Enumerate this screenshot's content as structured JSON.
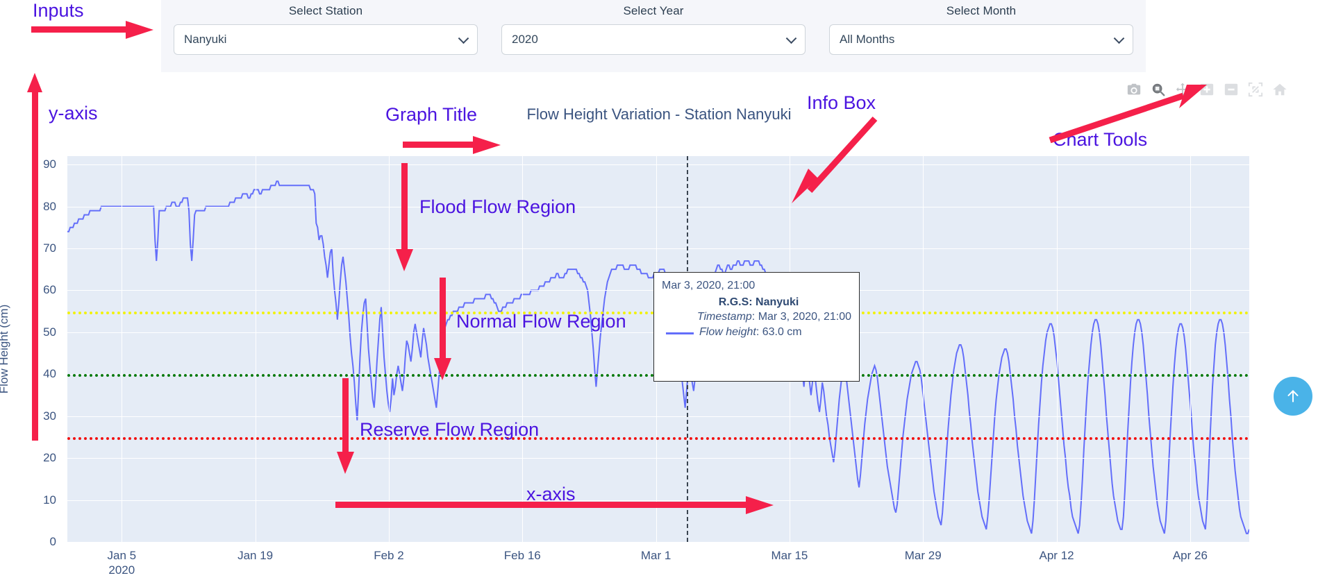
{
  "inputs": {
    "station": {
      "label": "Select Station",
      "value": "Nanyuki",
      "icon": "chevron-down-icon"
    },
    "year": {
      "label": "Select Year",
      "value": "2020",
      "icon": "chevron-down-icon"
    },
    "month": {
      "label": "Select Month",
      "value": "All Months",
      "icon": "chevron-down-icon"
    }
  },
  "modebar": {
    "buttons": [
      {
        "name": "download-plot-icon",
        "title": "Download plot as a png"
      },
      {
        "name": "zoom-icon",
        "title": "Zoom"
      },
      {
        "name": "pan-icon",
        "title": "Pan"
      },
      {
        "name": "zoom-in-icon",
        "title": "Zoom in"
      },
      {
        "name": "zoom-out-icon",
        "title": "Zoom out"
      },
      {
        "name": "autoscale-icon",
        "title": "Autoscale"
      },
      {
        "name": "reset-axes-icon",
        "title": "Reset axes"
      }
    ]
  },
  "info_box": {
    "header": "Mar 3, 2020, 21:00",
    "station_label": "R.G.S:",
    "station_value": "Nanyuki",
    "timestamp_label": "Timestamp",
    "timestamp_value": "Mar 3, 2020, 21:00",
    "flow_label": "Flow height",
    "flow_value": "63.0 cm"
  },
  "annotations": [
    {
      "name": "annotation-inputs",
      "text": "Inputs"
    },
    {
      "name": "annotation-y-axis",
      "text": "y-axis"
    },
    {
      "name": "annotation-graph-title",
      "text": "Graph Title"
    },
    {
      "name": "annotation-info-box",
      "text": "Info Box"
    },
    {
      "name": "annotation-chart-tools",
      "text": "Chart Tools"
    },
    {
      "name": "annotation-flood-flow-region",
      "text": "Flood Flow Region"
    },
    {
      "name": "annotation-normal-flow-region",
      "text": "Normal Flow Region"
    },
    {
      "name": "annotation-reserve-flow-region",
      "text": "Reserve Flow Region"
    },
    {
      "name": "annotation-x-axis",
      "text": "x-axis"
    }
  ],
  "scroll_top": {
    "name": "scroll-to-top-button",
    "icon": "arrow-up-icon",
    "color": "#4ab3e8"
  },
  "chart_data": {
    "type": "line",
    "title": "Flow Height Variation - Station Nanyuki",
    "xlabel": "",
    "ylabel": "Flow Height (cm)",
    "ylim": [
      0,
      92
    ],
    "yticks": [
      0,
      10,
      20,
      30,
      40,
      50,
      60,
      70,
      80,
      90
    ],
    "xticks": [
      "Jan 5\n2020",
      "Jan 19",
      "Feb 2",
      "Feb 16",
      "Mar 1",
      "Mar 15",
      "Mar 29",
      "Apr 12",
      "Apr 26"
    ],
    "xtick_positions_pct": [
      4.6,
      15.9,
      27.2,
      38.5,
      49.8,
      61.1,
      72.4,
      83.7,
      95.0
    ],
    "grid": true,
    "legend": "none",
    "plot_bgcolor": "#e5ecf6",
    "line_color": "#636efa",
    "cursor_line": {
      "label": "Mar 3, 2020, 21:00",
      "x_pct": 52.4,
      "color": "#3a4450",
      "style": "dashed"
    },
    "threshold_lines": [
      {
        "name": "flood-threshold",
        "value": 55,
        "color": "#f2f20a",
        "style": "dotted"
      },
      {
        "name": "normal-threshold",
        "value": 40,
        "color": "#0a7a10",
        "style": "dotted"
      },
      {
        "name": "reserve-threshold",
        "value": 25,
        "color": "#f21111",
        "style": "dotted"
      }
    ],
    "series": [
      {
        "name": "Flow height",
        "unit": "cm",
        "values": [
          74,
          74,
          75,
          75,
          75,
          76,
          76,
          76,
          77,
          77,
          77,
          77,
          78,
          78,
          78,
          78,
          79,
          79,
          79,
          79,
          79,
          79,
          79,
          79,
          80,
          80,
          80,
          80,
          80,
          80,
          80,
          80,
          80,
          80,
          80,
          80,
          80,
          80,
          80,
          80,
          80,
          80,
          80,
          80,
          80,
          80,
          80,
          80,
          80,
          80,
          80,
          80,
          80,
          80,
          80,
          80,
          80,
          80,
          80,
          80,
          80,
          80,
          72,
          67,
          72,
          79,
          79,
          79,
          79,
          79,
          80,
          80,
          80,
          80,
          81,
          81,
          81,
          80,
          80,
          80,
          81,
          81,
          82,
          82,
          82,
          82,
          79,
          71,
          67,
          72,
          78,
          79,
          79,
          79,
          79,
          79,
          79,
          79,
          80,
          80,
          80,
          80,
          80,
          80,
          80,
          80,
          80,
          80,
          80,
          80,
          80,
          80,
          80,
          80,
          80,
          81,
          81,
          81,
          81,
          82,
          82,
          82,
          82,
          82,
          83,
          83,
          83,
          83,
          82,
          82,
          83,
          83,
          84,
          84,
          84,
          84,
          83,
          83,
          84,
          84,
          84,
          84,
          84,
          84,
          85,
          85,
          85,
          85,
          86,
          86,
          85,
          85,
          85,
          85,
          85,
          85,
          85,
          85,
          85,
          85,
          85,
          85,
          85,
          85,
          85,
          85,
          85,
          85,
          85,
          85,
          85,
          85,
          84,
          84,
          84,
          83,
          76,
          75,
          72,
          73,
          73,
          71,
          68,
          66,
          63,
          66,
          69,
          70,
          64,
          60,
          57,
          53,
          57,
          62,
          66,
          68,
          65,
          62,
          58,
          54,
          49,
          45,
          42,
          38,
          33,
          29,
          36,
          44,
          50,
          54,
          57,
          58,
          52,
          46,
          42,
          38,
          34,
          32,
          37,
          43,
          48,
          53,
          56,
          50,
          44,
          40,
          36,
          33,
          31,
          34,
          39,
          35,
          37,
          40,
          42,
          40,
          38,
          36,
          39,
          44,
          48,
          47,
          45,
          43,
          46,
          50,
          52,
          50,
          48,
          46,
          44,
          48,
          51,
          49,
          47,
          44,
          42,
          40,
          38,
          36,
          34,
          32,
          36,
          40,
          44,
          47,
          49,
          51,
          52,
          53,
          53,
          54,
          54,
          55,
          55,
          55,
          55,
          56,
          56,
          56,
          56,
          57,
          57,
          57,
          57,
          57,
          57,
          57,
          58,
          58,
          58,
          58,
          58,
          58,
          58,
          58,
          59,
          59,
          59,
          59,
          58,
          58,
          57,
          57,
          56,
          55,
          55,
          55,
          56,
          56,
          56,
          57,
          57,
          57,
          57,
          57,
          58,
          58,
          58,
          58,
          58,
          59,
          59,
          59,
          59,
          59,
          59,
          59,
          60,
          60,
          60,
          60,
          60,
          60,
          61,
          61,
          61,
          61,
          62,
          62,
          62,
          62,
          63,
          63,
          63,
          63,
          64,
          64,
          63,
          63,
          63,
          63,
          64,
          64,
          65,
          65,
          65,
          65,
          65,
          65,
          65,
          64,
          64,
          63,
          63,
          62,
          62,
          61,
          60,
          57,
          54,
          50,
          46,
          41,
          37,
          41,
          45,
          49,
          52,
          55,
          58,
          60,
          62,
          63,
          64,
          65,
          65,
          65,
          65,
          66,
          66,
          66,
          66,
          66,
          65,
          65,
          65,
          65,
          66,
          66,
          66,
          66,
          66,
          65,
          65,
          65,
          64,
          64,
          64,
          64,
          64,
          63,
          63,
          63,
          63,
          64,
          64,
          64,
          64,
          65,
          65,
          65,
          65,
          64,
          64,
          63,
          63,
          63,
          62,
          62,
          58,
          54,
          50,
          46,
          42,
          38,
          35,
          32,
          36,
          40,
          43,
          40,
          38,
          36,
          39,
          44,
          42,
          45,
          49,
          52,
          55,
          57,
          59,
          60,
          61,
          62,
          63,
          64,
          64,
          65,
          66,
          66,
          65,
          65,
          64,
          64,
          65,
          66,
          66,
          65,
          65,
          66,
          66,
          66,
          67,
          67,
          66,
          66,
          66,
          67,
          67,
          67,
          67,
          66,
          66,
          66,
          67,
          67,
          67,
          67,
          66,
          66,
          65,
          65,
          64,
          64,
          63,
          62,
          62,
          61,
          61,
          60,
          59,
          58,
          58,
          57,
          56,
          55,
          54,
          53,
          51,
          49,
          47,
          45,
          43,
          41,
          39,
          43,
          47,
          44,
          40,
          37,
          41,
          45,
          42,
          38,
          35,
          38,
          42,
          39,
          36,
          33,
          31,
          34,
          38,
          36,
          33,
          30,
          28,
          25,
          23,
          21,
          19,
          22,
          26,
          30,
          34,
          37,
          40,
          42,
          41,
          39,
          36,
          33,
          30,
          27,
          24,
          21,
          18,
          15,
          13,
          16,
          20,
          24,
          28,
          31,
          34,
          36,
          38,
          40,
          41,
          42,
          41,
          39,
          36,
          33,
          30,
          27,
          24,
          21,
          18,
          16,
          14,
          12,
          10,
          8,
          7,
          9,
          13,
          17,
          21,
          25,
          28,
          31,
          34,
          36,
          38,
          40,
          41,
          42,
          43,
          43,
          42,
          41,
          39,
          36,
          33,
          30,
          27,
          24,
          21,
          18,
          15,
          12,
          10,
          8,
          6,
          5,
          4,
          7,
          12,
          17,
          22,
          27,
          31,
          35,
          38,
          41,
          43,
          45,
          46,
          47,
          47,
          46,
          44,
          41,
          38,
          35,
          31,
          28,
          24,
          21,
          18,
          15,
          12,
          10,
          8,
          6,
          5,
          4,
          3,
          6,
          10,
          15,
          20,
          25,
          30,
          34,
          37,
          40,
          42,
          44,
          45,
          46,
          46,
          45,
          43,
          40,
          37,
          34,
          30,
          27,
          23,
          20,
          17,
          14,
          11,
          9,
          7,
          5,
          4,
          3,
          2,
          5,
          10,
          16,
          22,
          28,
          33,
          38,
          42,
          45,
          48,
          50,
          51,
          52,
          52,
          51,
          49,
          46,
          43,
          39,
          35,
          31,
          27,
          23,
          20,
          16,
          13,
          11,
          8,
          6,
          5,
          4,
          3,
          2,
          4,
          9,
          15,
          22,
          28,
          34,
          39,
          43,
          47,
          50,
          52,
          53,
          53,
          52,
          50,
          47,
          43,
          39,
          35,
          30,
          26,
          22,
          18,
          14,
          11,
          9,
          7,
          5,
          4,
          3,
          3,
          6,
          12,
          19,
          26,
          32,
          38,
          43,
          47,
          50,
          52,
          53,
          53,
          52,
          50,
          47,
          43,
          39,
          35,
          30,
          26,
          22,
          18,
          15,
          12,
          9,
          7,
          5,
          4,
          3,
          2,
          5,
          11,
          18,
          25,
          31,
          37,
          42,
          46,
          49,
          51,
          52,
          52,
          51,
          49,
          46,
          42,
          38,
          34,
          30,
          25,
          21,
          18,
          14,
          11,
          9,
          7,
          5,
          4,
          3,
          8,
          15,
          23,
          30,
          37,
          42,
          47,
          50,
          52,
          53,
          53,
          52,
          50,
          47,
          43,
          39,
          34,
          30,
          25,
          21,
          17,
          14,
          11,
          8,
          6,
          5,
          4,
          3,
          2,
          2,
          3
        ]
      }
    ]
  }
}
